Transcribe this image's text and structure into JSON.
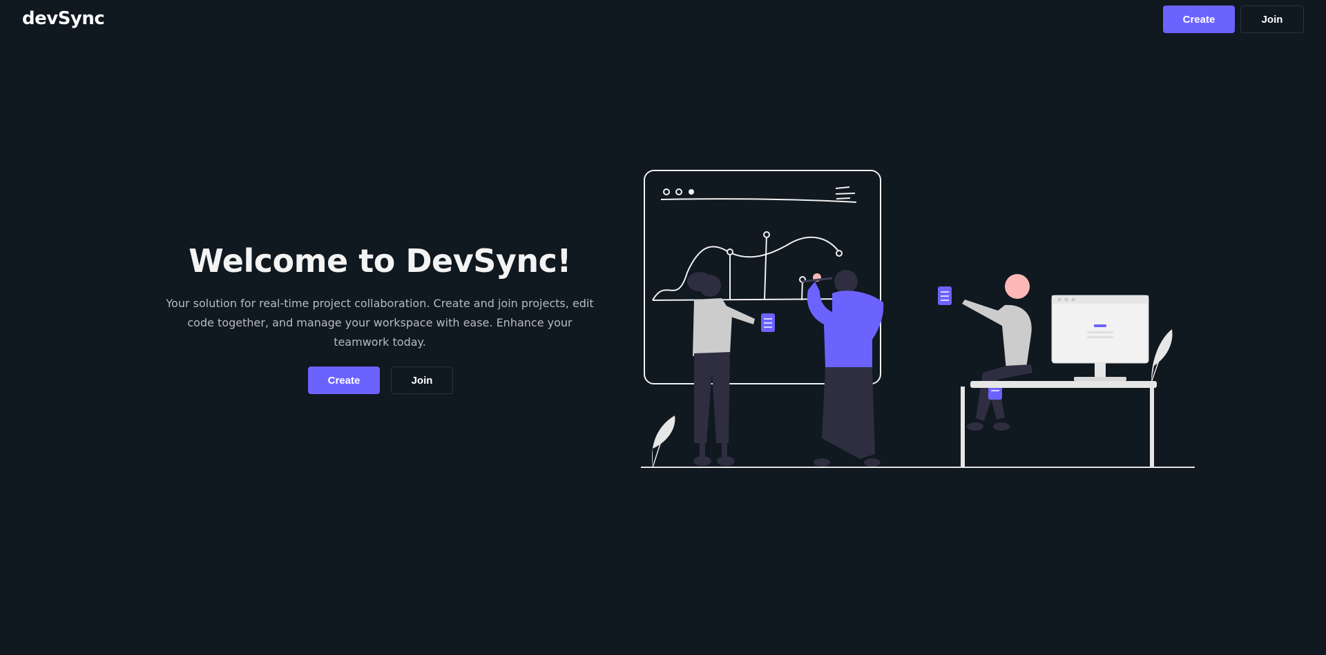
{
  "header": {
    "logo": "devSync",
    "create_label": "Create",
    "join_label": "Join"
  },
  "hero": {
    "title": "Welcome to DevSync!",
    "subtitle": "Your solution for real-time project collaboration. Create and join projects, edit code together, and manage your workspace with ease. Enhance your teamwork today.",
    "create_label": "Create",
    "join_label": "Join"
  },
  "colors": {
    "background": "#101820",
    "accent": "#6c63ff",
    "text_primary": "#f3f3f3",
    "text_secondary": "#b7bcc2"
  },
  "illustration": {
    "icon": "team-collaboration-illustration"
  }
}
